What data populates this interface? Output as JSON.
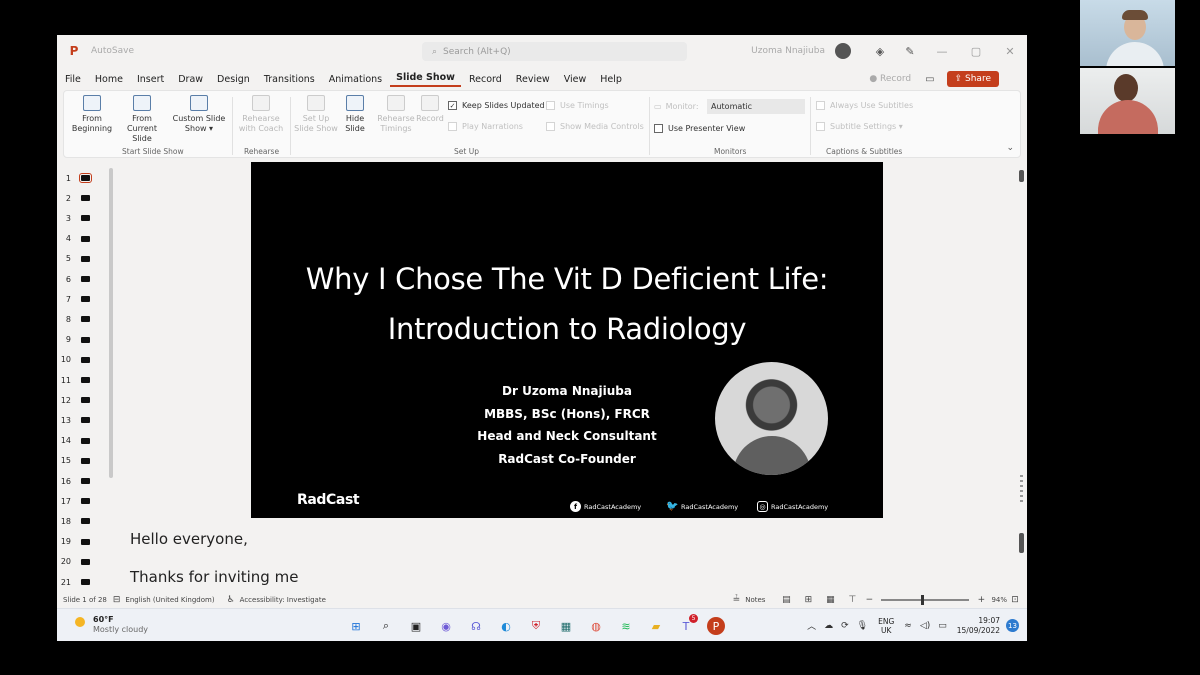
{
  "app": {
    "title_faded": "AutoSave",
    "search_placeholder": "Search (Alt+Q)",
    "user_name": "Uzoma Nnajiuba"
  },
  "menu": {
    "items": [
      "File",
      "Home",
      "Insert",
      "Draw",
      "Design",
      "Transitions",
      "Animations",
      "Slide Show",
      "Record",
      "Review",
      "View",
      "Help"
    ],
    "active": "Slide Show",
    "record_label": "Record",
    "share_label": "Share"
  },
  "ribbon": {
    "from_beginning": [
      "From",
      "Beginning"
    ],
    "from_current": [
      "From",
      "Current Slide"
    ],
    "custom_show": [
      "Custom Slide",
      "Show ▾"
    ],
    "rehearse": [
      "Rehearse",
      "with Coach"
    ],
    "setup_show": [
      "Set Up",
      "Slide Show"
    ],
    "hide_slide": [
      "Hide",
      "Slide"
    ],
    "rehearse_timings": [
      "Rehearse",
      "Timings"
    ],
    "record_btn": "Record",
    "keep_updated": "Keep Slides Updated",
    "play_narrations": "Play Narrations",
    "use_timings": "Use Timings",
    "show_media_controls": "Show Media Controls",
    "monitor_label": "Monitor:",
    "monitor_value": "Automatic",
    "use_presenter_view": "Use Presenter View",
    "always_subtitles": "Always Use Subtitles",
    "subtitle_settings": "Subtitle Settings ▾",
    "groups": {
      "start": "Start Slide Show",
      "rehearse": "Rehearse",
      "setup": "Set Up",
      "monitors": "Monitors",
      "captions": "Captions & Subtitles"
    }
  },
  "thumbnails": [
    "1",
    "2",
    "3",
    "4",
    "5",
    "6",
    "7",
    "8",
    "9",
    "10",
    "11",
    "12",
    "13",
    "14",
    "15",
    "16",
    "17",
    "18",
    "19",
    "20",
    "21"
  ],
  "slide": {
    "title_line1": "Why I Chose The Vit D Deficient Life:",
    "title_line2": "Introduction to Radiology",
    "presenter": [
      "Dr Uzoma Nnajiuba",
      "MBBS, BSc (Hons), FRCR",
      "Head and Neck Consultant",
      "RadCast Co-Founder"
    ],
    "logo": "RadCast",
    "social": [
      "RadCastAcademy",
      "RadCastAcademy",
      "RadCastAcademy"
    ]
  },
  "notes": {
    "line1": "Hello everyone,",
    "line2": "Thanks for inviting me"
  },
  "status": {
    "slide_count": "Slide 1 of 28",
    "language": "English (United Kingdom)",
    "accessibility": "Accessibility: Investigate",
    "notes_btn": "Notes",
    "zoom": "94%",
    "zoom_fraction": 0.47
  },
  "taskbar": {
    "temperature": "60°F",
    "condition": "Mostly cloudy",
    "lang_line1": "ENG",
    "lang_line2": "UK",
    "time": "19:07",
    "date": "15/09/2022",
    "notifications": "13",
    "teams_badge": "5"
  },
  "colors": {
    "accent": "#c43e1c",
    "slide_bg": "#000000",
    "taskbar_bg": "#eef1f6"
  }
}
